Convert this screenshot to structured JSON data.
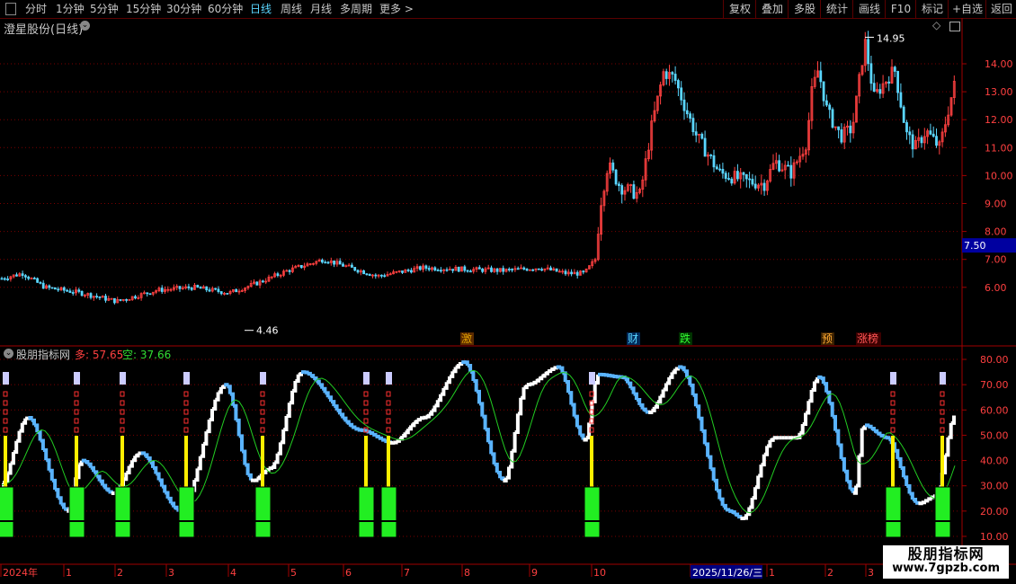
{
  "toolbar": {
    "periods": [
      "分时",
      "1分钟",
      "5分钟",
      "15分钟",
      "30分钟",
      "60分钟",
      "日线",
      "周线",
      "月线",
      "多周期",
      "更多 >"
    ],
    "active_period": "日线",
    "right_buttons": [
      "复权",
      "叠加",
      "多股",
      "统计",
      "画线",
      "F10",
      "标记",
      "+自选",
      "返回"
    ]
  },
  "main_chart": {
    "title": "澄星股份(日线)",
    "high_label": "14.95",
    "low_label": "4.46",
    "price_marker": "7.50",
    "y_ticks": [
      "14.00",
      "13.00",
      "12.00",
      "11.00",
      "10.00",
      "9.00",
      "8.00",
      "7.00",
      "6.00"
    ],
    "event_tags": [
      {
        "text": "激",
        "color": "#e0a000",
        "bg": "#5a2a00"
      },
      {
        "text": "财",
        "color": "#5ad6ff",
        "bg": "#002a5a"
      },
      {
        "text": "跌",
        "color": "#33ff33",
        "bg": "#003300"
      },
      {
        "text": "预",
        "color": "#ffaa33",
        "bg": "#3a2000"
      },
      {
        "text": "涨榜",
        "color": "#ff5555",
        "bg": "#3a0000"
      }
    ]
  },
  "indicator": {
    "name": "股朋指标网",
    "long_label": "多: 57.65",
    "short_label": "空: 37.66",
    "y_ticks": [
      "80.00",
      "70.00",
      "60.00",
      "50.00",
      "40.00",
      "30.00",
      "20.00",
      "10.00"
    ]
  },
  "date_axis": {
    "labels": [
      "2024年",
      "1",
      "2",
      "3",
      "4",
      "5",
      "6",
      "7",
      "8",
      "9",
      "10",
      "2025/11/26/三",
      "1",
      "2",
      "3"
    ]
  },
  "watermark": {
    "title": "股朋指标网",
    "url": "www.7gpzb.com"
  },
  "colors": {
    "grid": "#7a0000",
    "up": "#ff4040",
    "down": "#5ad6ff",
    "white_line": "#ffffff",
    "blue_line": "#5ab4ff",
    "ma": "#22cc22",
    "signal_yellow": "#ffee00",
    "signal_green": "#22ee22",
    "signal_lavender": "#ccccff",
    "axis_text": "#ff4040"
  }
}
